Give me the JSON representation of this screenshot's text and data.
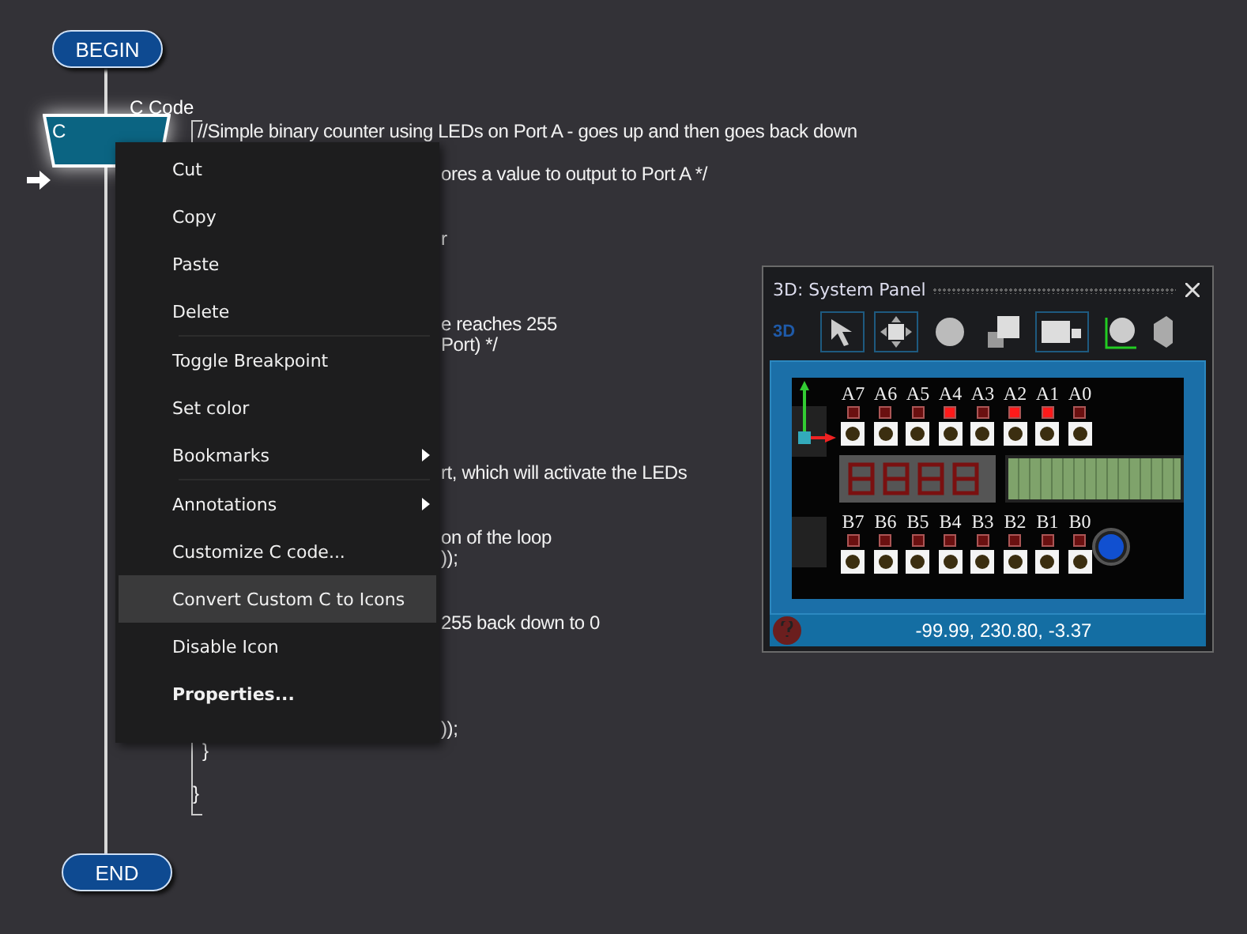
{
  "flowchart": {
    "begin": "BEGIN",
    "end": "END",
    "icon": {
      "title": "C Code",
      "glyph": "C",
      "selected": true
    }
  },
  "code_lines": [
    "//Simple binary counter using LEDs on Port A - goes up and then goes back down",
    "ores a value to output to Port A */",
    "r",
    "e reaches 255",
    "Port) */",
    "rt, which will activate the LEDs",
    "on of the loop",
    "));",
    "255 back down to 0",
    "));",
    "}",
    "}"
  ],
  "context_menu": [
    {
      "label": "Cut",
      "selected": false,
      "submenu": false,
      "bold": false
    },
    {
      "label": "Copy",
      "selected": false,
      "submenu": false,
      "bold": false
    },
    {
      "label": "Paste",
      "selected": false,
      "submenu": false,
      "bold": false
    },
    {
      "label": "Delete",
      "selected": false,
      "submenu": false,
      "bold": false,
      "separator_after": true
    },
    {
      "label": "Toggle Breakpoint",
      "selected": false,
      "submenu": false,
      "bold": false
    },
    {
      "label": "Set color",
      "selected": false,
      "submenu": false,
      "bold": false
    },
    {
      "label": "Bookmarks",
      "selected": false,
      "submenu": true,
      "bold": false,
      "separator_after": true
    },
    {
      "label": "Annotations",
      "selected": false,
      "submenu": true,
      "bold": false
    },
    {
      "label": "Customize C code...",
      "selected": false,
      "submenu": false,
      "bold": false
    },
    {
      "label": "Convert Custom C to Icons",
      "selected": true,
      "submenu": false,
      "bold": false
    },
    {
      "label": "Disable Icon",
      "selected": false,
      "submenu": false,
      "bold": false
    },
    {
      "label": "Properties...",
      "selected": false,
      "submenu": false,
      "bold": true
    }
  ],
  "system_panel": {
    "title": "3D: System Panel",
    "toolbar_label": "3D",
    "port_a": [
      {
        "label": "A7",
        "on": false
      },
      {
        "label": "A6",
        "on": false
      },
      {
        "label": "A5",
        "on": false
      },
      {
        "label": "A4",
        "on": true
      },
      {
        "label": "A3",
        "on": false
      },
      {
        "label": "A2",
        "on": true
      },
      {
        "label": "A1",
        "on": true
      },
      {
        "label": "A0",
        "on": false
      }
    ],
    "port_b": [
      {
        "label": "B7",
        "on": false
      },
      {
        "label": "B6",
        "on": false
      },
      {
        "label": "B5",
        "on": false
      },
      {
        "label": "B4",
        "on": false
      },
      {
        "label": "B3",
        "on": false
      },
      {
        "label": "B2",
        "on": false
      },
      {
        "label": "B1",
        "on": false
      },
      {
        "label": "B0",
        "on": false
      }
    ],
    "coordinates": "-99.99, 230.80, -3.37"
  }
}
